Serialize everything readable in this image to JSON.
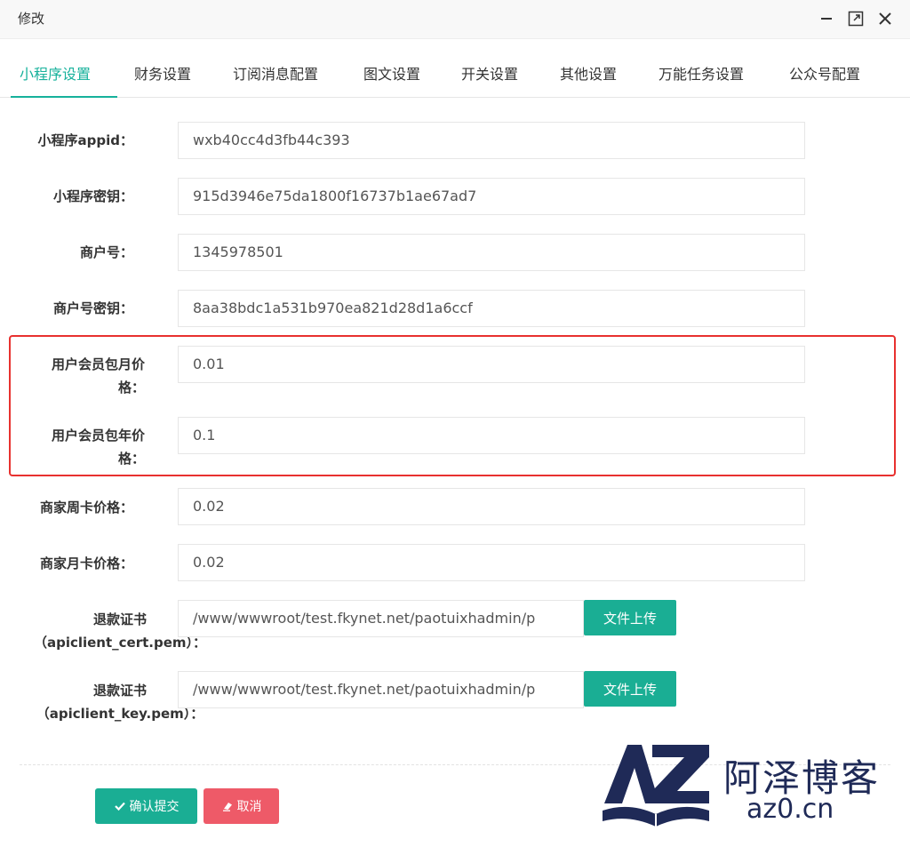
{
  "window": {
    "title": "修改"
  },
  "tabs": [
    {
      "label": "小程序设置",
      "active": true
    },
    {
      "label": "财务设置"
    },
    {
      "label": "订阅消息配置"
    },
    {
      "label": "图文设置"
    },
    {
      "label": "开关设置"
    },
    {
      "label": "其他设置"
    },
    {
      "label": "万能任务设置"
    },
    {
      "label": "公众号配置"
    }
  ],
  "form": {
    "appid": {
      "label": "小程序appid：",
      "value": "wxb40cc4d3fb44c393"
    },
    "secret": {
      "label": "小程序密钥：",
      "value": "915d3946e75da1800f16737b1ae67ad7"
    },
    "mch_id": {
      "label": "商户号：",
      "value": "1345978501"
    },
    "mch_key": {
      "label": "商户号密钥：",
      "value": "8aa38bdc1a531b970ea821d28d1a6ccf"
    },
    "member_month": {
      "label_line1": "用户会员包月价",
      "label_line2": "格：",
      "value": "0.01"
    },
    "member_year": {
      "label_line1": "用户会员包年价",
      "label_line2": "格：",
      "value": "0.1"
    },
    "merchant_week": {
      "label": "商家周卡价格：",
      "value": "0.02"
    },
    "merchant_month": {
      "label": "商家月卡价格：",
      "value": "0.02"
    },
    "cert": {
      "label_line1": "退款证书",
      "label_line2": "（apiclient_cert.pem）：",
      "value": "/www/wwwroot/test.fkynet.net/paotuixhadmin/p",
      "upload_label": "文件上传"
    },
    "key": {
      "label_line1": "退款证书",
      "label_line2": "（apiclient_key.pem）：",
      "value": "/www/wwwroot/test.fkynet.net/paotuixhadmin/p",
      "upload_label": "文件上传"
    }
  },
  "actions": {
    "submit_label": "确认提交",
    "cancel_label": "取消"
  },
  "watermark": {
    "name": "阿泽博客",
    "url": "az0.cn"
  },
  "colors": {
    "accent": "#16b19b",
    "danger": "#ee5a68",
    "highlight": "#e8312f"
  }
}
